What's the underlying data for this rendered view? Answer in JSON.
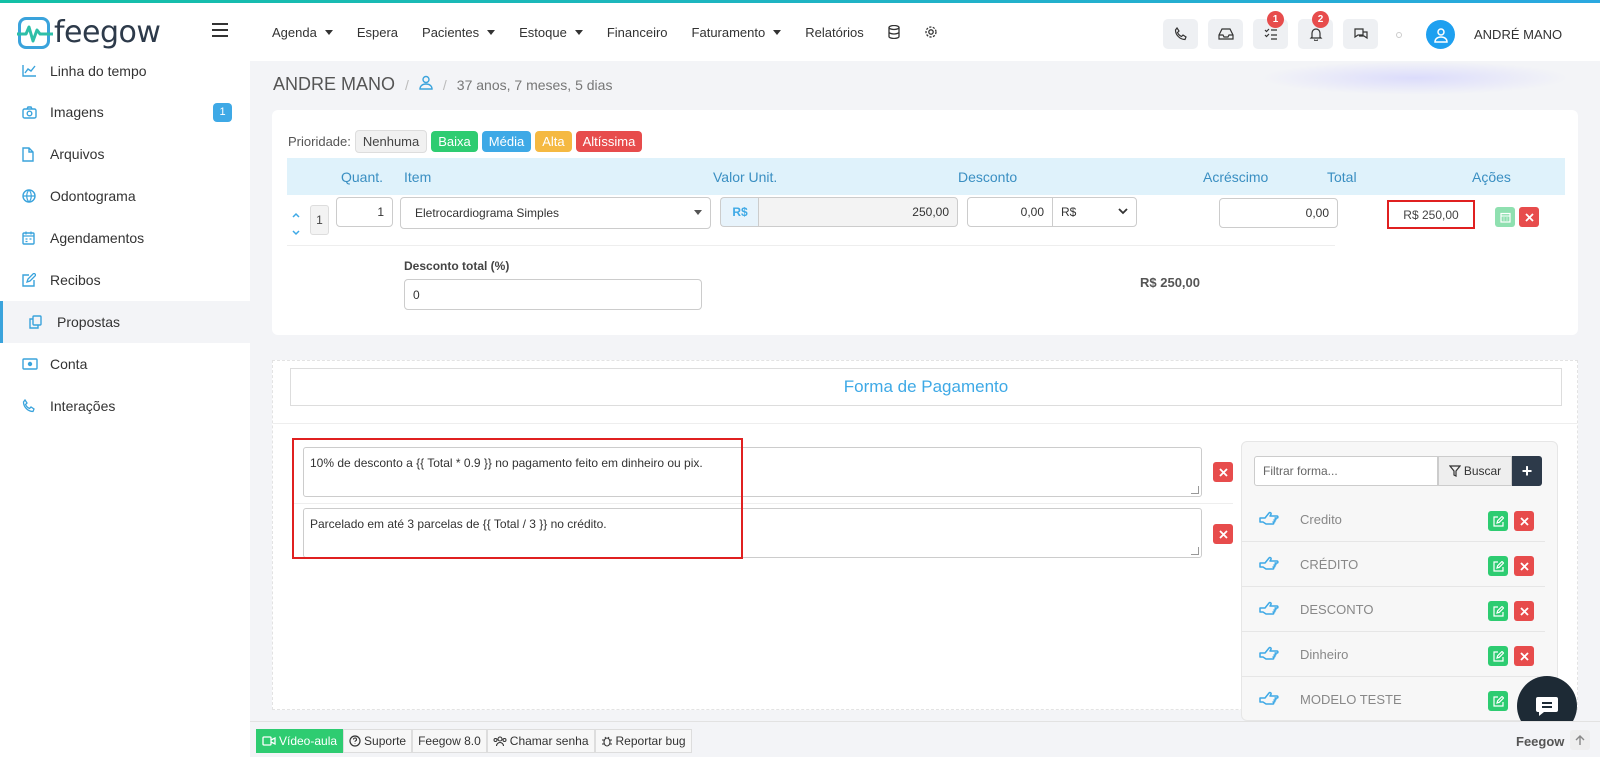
{
  "brand": {
    "name": "feegow"
  },
  "nav": {
    "items": [
      {
        "label": "Agenda",
        "dropdown": true
      },
      {
        "label": "Espera",
        "dropdown": false
      },
      {
        "label": "Pacientes",
        "dropdown": true
      },
      {
        "label": "Estoque",
        "dropdown": true
      },
      {
        "label": "Financeiro",
        "dropdown": false
      },
      {
        "label": "Faturamento",
        "dropdown": true
      },
      {
        "label": "Relatórios",
        "dropdown": false
      }
    ]
  },
  "toolbar": {
    "tasks_badge": "1",
    "notifications_badge": "2"
  },
  "user": {
    "name": "ANDRÉ MANO"
  },
  "sidebar": {
    "items": [
      {
        "label": "Linha do tempo",
        "icon": "chart-line-icon"
      },
      {
        "label": "Imagens",
        "icon": "camera-icon",
        "badge": "1"
      },
      {
        "label": "Arquivos",
        "icon": "file-icon"
      },
      {
        "label": "Odontograma",
        "icon": "globe-icon"
      },
      {
        "label": "Agendamentos",
        "icon": "calendar-icon"
      },
      {
        "label": "Recibos",
        "icon": "edit-icon"
      },
      {
        "label": "Propostas",
        "icon": "copy-icon",
        "active": true
      },
      {
        "label": "Conta",
        "icon": "money-icon"
      },
      {
        "label": "Interações",
        "icon": "phone-icon"
      }
    ]
  },
  "breadcrumb": {
    "patient": "ANDRE MANO",
    "sep": "/",
    "age": "37 anos, 7 meses, 5 dias"
  },
  "priority": {
    "label": "Prioridade:",
    "options": [
      "Nenhuma",
      "Baixa",
      "Média",
      "Alta",
      "Altíssima"
    ]
  },
  "table": {
    "headers": {
      "quant": "Quant.",
      "item": "Item",
      "valor_unit": "Valor Unit.",
      "desconto": "Desconto",
      "acrescimo": "Acréscimo",
      "total": "Total",
      "acoes": "Ações"
    },
    "row": {
      "num": "1",
      "quant": "1",
      "item": "Eletrocardiograma Simples",
      "currency": "R$",
      "valor_unit": "250,00",
      "desconto": "0,00",
      "desconto_tipo": "R$",
      "acrescimo": "0,00",
      "total": "R$ 250,00"
    },
    "desconto_total_label": "Desconto total (%)",
    "desconto_total_value": "0",
    "sum_total": "R$ 250,00"
  },
  "pagamento": {
    "title": "Forma de Pagamento",
    "textos": [
      "10% de desconto a {{ Total * 0.9 }} no pagamento feito em dinheiro ou pix.",
      "Parcelado em até 3 parcelas de {{ Total / 3 }} no crédito."
    ],
    "filter_placeholder": "Filtrar forma...",
    "buscar_label": "Buscar",
    "plus_label": "+",
    "formas": [
      "Credito",
      "CRÉDITO",
      "DESCONTO",
      "Dinheiro",
      "MODELO TESTE"
    ]
  },
  "footer": {
    "video": "Vídeo-aula",
    "suporte": "Suporte",
    "versao": "Feegow 8.0",
    "chamar": "Chamar senha",
    "bug": "Reportar bug",
    "brand": "Feegow"
  }
}
